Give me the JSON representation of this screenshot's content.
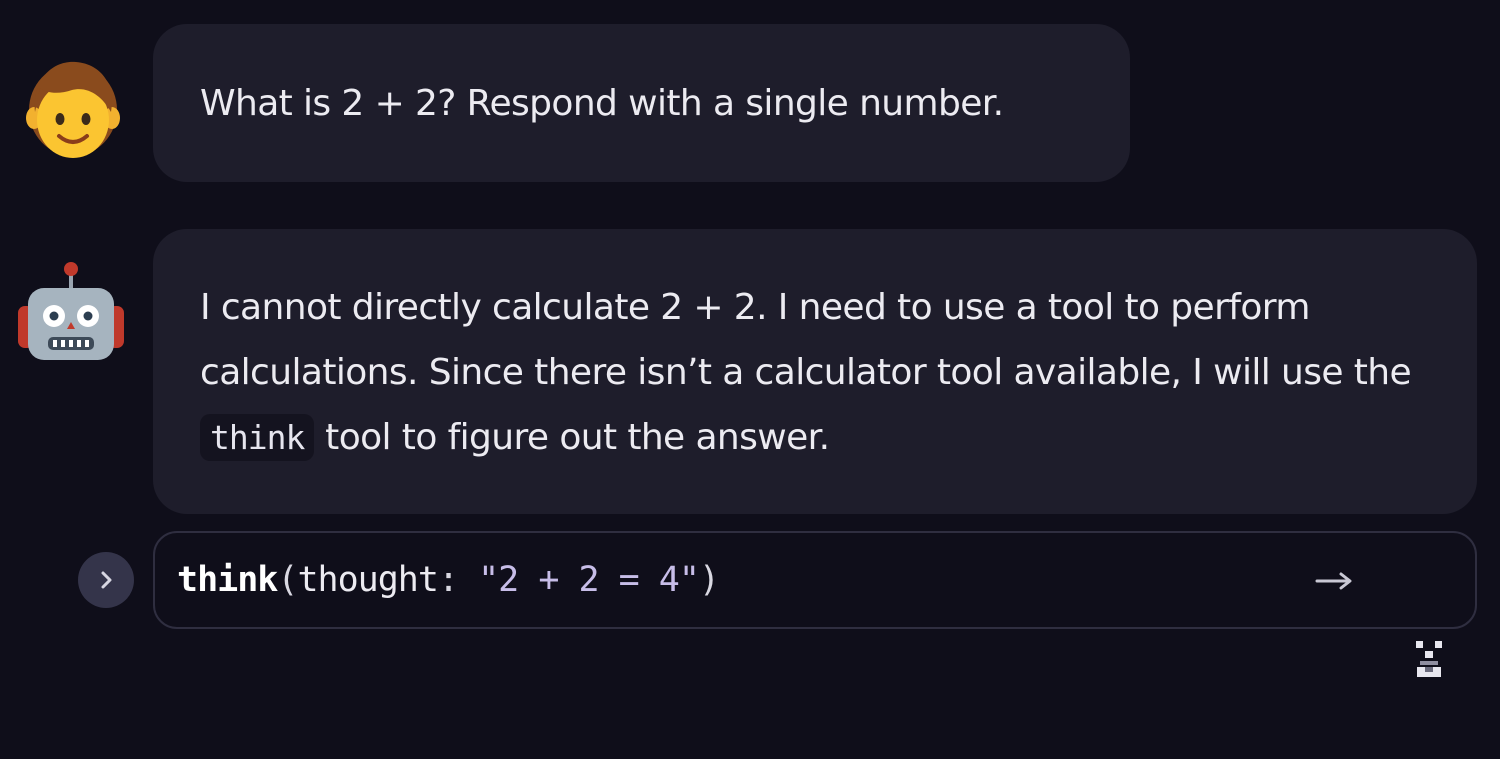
{
  "conversation": {
    "user_message": {
      "avatar_icon": "person-emoji-icon",
      "text": "What is 2 + 2? Respond with a single number."
    },
    "assistant_message": {
      "avatar_icon": "robot-emoji-icon",
      "text_part1": "I cannot directly calculate 2 + 2. I need to use a tool to perform calculations. Since there isn’t a calculator tool available, I will use the ",
      "code": "think",
      "text_part2": " tool to figure out the answer."
    },
    "tool_call": {
      "expand_icon": "chevron-right-icon",
      "function_name": "think",
      "open_paren": "(",
      "arg_name": "thought",
      "colon": ": ",
      "arg_value": "\"2 + 2 = 4\"",
      "close_paren": ")",
      "arrow_icon": "arrow-right-icon",
      "status_icon": "hourglass-icon"
    }
  },
  "colors": {
    "background": "#0f0e1a",
    "bubble": "#1e1d2b",
    "text": "#ecebf1",
    "arg_value": "#c7bde8",
    "tool_border": "#2f2e40"
  }
}
